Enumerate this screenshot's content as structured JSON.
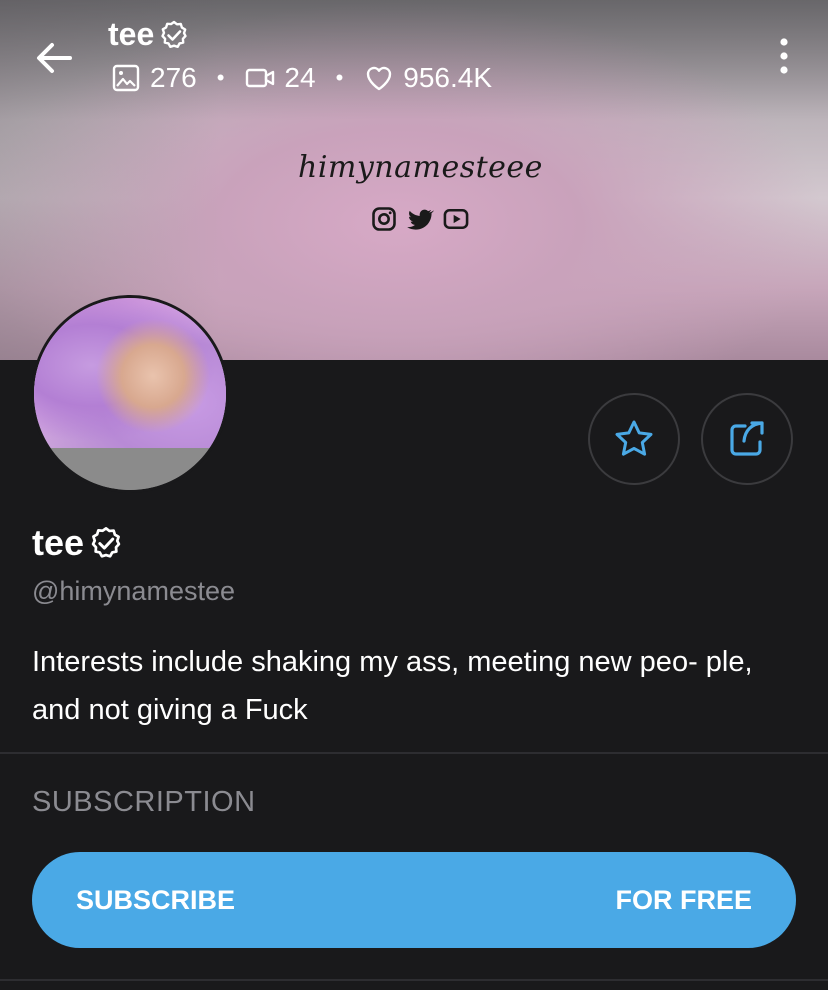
{
  "header": {
    "title": "tee",
    "stats": {
      "photos": "276",
      "videos": "24",
      "likes": "956.4K"
    }
  },
  "cover": {
    "script_text": "himynamesteee"
  },
  "profile": {
    "name": "tee",
    "handle": "@himynamestee",
    "bio": "Interests include shaking my ass, meeting new peo- ple, and not giving a Fuck"
  },
  "subscription": {
    "section_title": "SUBSCRIPTION",
    "button_label": "SUBSCRIBE",
    "button_price": "FOR FREE"
  },
  "colors": {
    "accent": "#4aa9e6",
    "background": "#19191b",
    "muted_text": "#8b8b91"
  },
  "icons": {
    "back": "back-arrow-icon",
    "verified": "verified-badge-icon",
    "photos": "image-icon",
    "videos": "video-icon",
    "likes": "heart-icon",
    "menu": "more-vertical-icon",
    "favorite": "star-icon",
    "share": "share-icon"
  }
}
